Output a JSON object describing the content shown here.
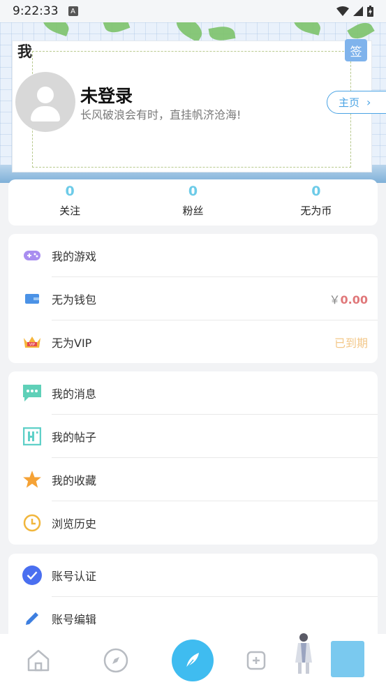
{
  "status_bar": {
    "time": "9:22:33",
    "a_badge": "A"
  },
  "profile": {
    "page_title": "我",
    "sign_label": "签",
    "user_name": "未登录",
    "motto": "长风破浪会有时，直挂帆济沧海!",
    "home_label": "主页"
  },
  "stats": [
    {
      "value": "0",
      "label": "关注"
    },
    {
      "value": "0",
      "label": "粉丝"
    },
    {
      "value": "0",
      "label": "无为币"
    }
  ],
  "group1": [
    {
      "label": "我的游戏",
      "icon": "gamepad-icon"
    },
    {
      "label": "无为钱包",
      "icon": "wallet-icon",
      "value_prefix": "￥",
      "value": "0.00"
    },
    {
      "label": "无为VIP",
      "icon": "vip-crown-icon",
      "value": "已到期"
    }
  ],
  "group2": [
    {
      "label": "我的消息",
      "icon": "message-icon"
    },
    {
      "label": "我的帖子",
      "icon": "hi-post-icon"
    },
    {
      "label": "我的收藏",
      "icon": "star-icon"
    },
    {
      "label": "浏览历史",
      "icon": "clock-icon"
    }
  ],
  "group3": [
    {
      "label": "账号认证",
      "icon": "verified-icon"
    },
    {
      "label": "账号编辑",
      "icon": "pencil-icon"
    }
  ],
  "colors": {
    "accent": "#3fbcf0",
    "stat_number": "#6dcbe8",
    "wallet_value": "#e0787a",
    "vip_expired": "#f3c88a"
  }
}
